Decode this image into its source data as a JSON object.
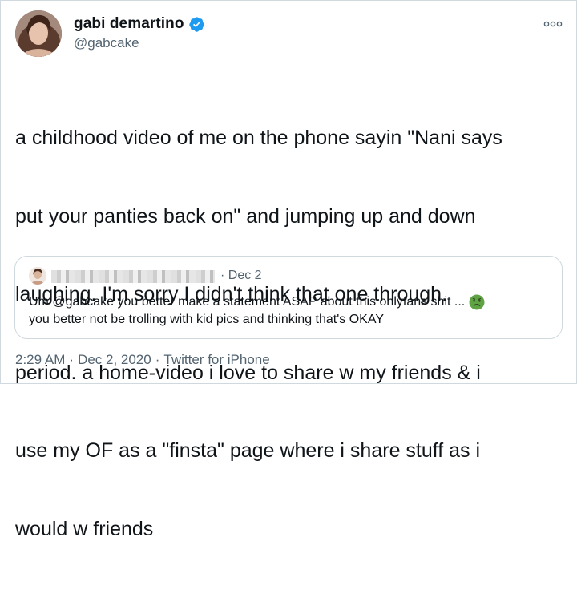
{
  "author": {
    "name": "gabi demartino",
    "handle": "@gabcake",
    "verified_icon": "verified-badge-icon",
    "avatar_icon": "user-avatar"
  },
  "menu": {
    "icon": "more-options-icon"
  },
  "tweet": {
    "lines": [
      "a childhood video of me on the phone sayin \"Nani says",
      "put your panties back on\" and jumping up and down",
      "laughing. I'm sorry I didn't think that one through.",
      "period. a home-video i love to share w my friends & i",
      "use my OF as a \"finsta\" page where i share stuff as i",
      "would w friends"
    ]
  },
  "quoted_tweet": {
    "date": "· Dec 2",
    "line1": "Um @gabcake you better make a statement ASAP about this onlyfans shit ...",
    "line2": "you better not be trolling with kid pics and thinking that's OKAY",
    "emoji_icon": "nauseated-face-emoji"
  },
  "meta": {
    "time": "2:29 AM",
    "date": "Dec 2, 2020",
    "source": "Twitter for iPhone",
    "separator": "·"
  },
  "colors": {
    "text": "#0f1419",
    "secondary": "#536471",
    "border": "#cfd9de",
    "verified": "#1d9bf0"
  }
}
